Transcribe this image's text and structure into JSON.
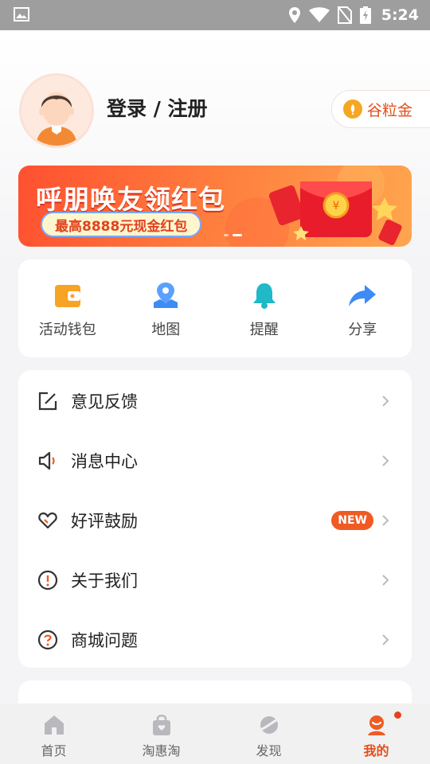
{
  "status_bar": {
    "time": "5:24"
  },
  "profile": {
    "login_label": "登录 / 注册"
  },
  "grain_gold": {
    "label": "谷粒金"
  },
  "banner": {
    "title": "呼朋唤友领红包",
    "subtitle": "最高8888元现金红包"
  },
  "quick_actions": [
    {
      "label": "活动钱包",
      "icon": "wallet-icon",
      "color": "#f7a324"
    },
    {
      "label": "地图",
      "icon": "map-pin-icon",
      "color": "#3d8cf5"
    },
    {
      "label": "提醒",
      "icon": "bell-icon",
      "color": "#1fb9c8"
    },
    {
      "label": "分享",
      "icon": "share-icon",
      "color": "#3d8cf5"
    }
  ],
  "menu": [
    {
      "label": "意见反馈",
      "icon": "edit-icon"
    },
    {
      "label": "消息中心",
      "icon": "speaker-icon"
    },
    {
      "label": "好评鼓励",
      "icon": "heart-icon",
      "badge": "NEW"
    },
    {
      "label": "关于我们",
      "icon": "info-icon"
    },
    {
      "label": "商城问题",
      "icon": "question-icon"
    }
  ],
  "tabs": [
    {
      "label": "首页",
      "icon": "home-icon",
      "active": false
    },
    {
      "label": "淘惠淘",
      "icon": "bag-icon",
      "active": false
    },
    {
      "label": "发现",
      "icon": "planet-icon",
      "active": false
    },
    {
      "label": "我的",
      "icon": "profile-icon",
      "active": true
    }
  ],
  "colors": {
    "accent": "#e24f1b",
    "badge": "#f05a23"
  }
}
